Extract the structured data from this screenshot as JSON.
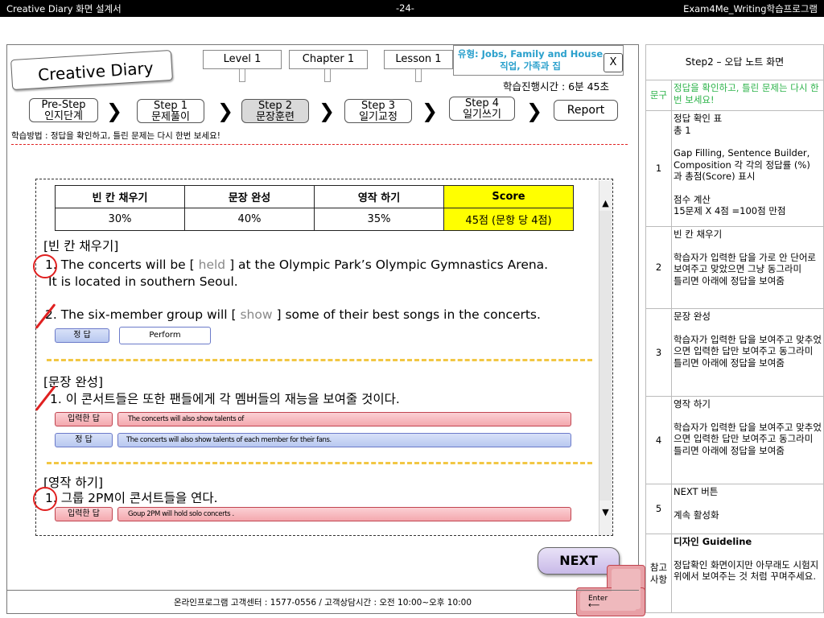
{
  "topbar": {
    "left": "Creative Diary 화면 설계서",
    "center": "-24-",
    "right": "Exam4Me_Writing학습프로그램"
  },
  "logo": "Creative Diary",
  "tabs": {
    "level": "Level 1",
    "chapter": "Chapter 1",
    "lesson": "Lesson 1"
  },
  "type_box": {
    "line1": "유형: Jobs, Family and House",
    "line2": "직업, 가족과 집"
  },
  "close": "X",
  "timer": "학습진행시간 : 6분 45초",
  "steps": [
    {
      "line1": "Pre-Step",
      "line2": "인지단계"
    },
    {
      "line1": "Step 1",
      "line2": "문제풀이"
    },
    {
      "line1": "Step 2",
      "line2": "문장훈련"
    },
    {
      "line1": "Step 3",
      "line2": "일기교정"
    },
    {
      "line1": "Step 4",
      "line2": "일기쓰기"
    }
  ],
  "report": "Report",
  "method": "학습방법 : 정답을 확인하고, 틀린 문제는 다시 한번 보세요!",
  "score_table": {
    "headers": [
      "빈 칸 채우기",
      "문장 완성",
      "영작 하기",
      "Score"
    ],
    "values": [
      "30%",
      "40%",
      "35%",
      "45점 (문항 당 4점)"
    ]
  },
  "gap": {
    "title": "[빈 칸 채우기]",
    "q1_pre": "1. The concerts will be [",
    "q1_ans": "held",
    "q1_post": "] at the Olympic Park’s Olympic Gymnastics   Arena.",
    "q1_line2": "It is located in southern Seoul.",
    "q2_pre": "2. The six-member group will [",
    "q2_ans": "show",
    "q2_post": "] some of their best songs in the concerts.",
    "answer_label": "정      답",
    "answer": "Perform"
  },
  "sentence": {
    "title": "[문장 완성]",
    "q1": "1. 이 콘서트들은 또한 팬들에게 각 멤버들의 재능을 보여줄 것이다.",
    "input_label": "입력한 답",
    "input": "The concerts will also show talents of",
    "answer_label": "정      답",
    "answer": "The concerts will also show talents of each member for their fans."
  },
  "composition": {
    "title": "[영작 하기]",
    "q1": "1. 그룹 2PM이 콘서트들을 연다.",
    "input_label": "입력한 답",
    "input": "Goup 2PM will hold solo concerts ."
  },
  "next": "NEXT",
  "enter": "Enter",
  "footer": "온라인프로그램 고객센터 : 1577-0556   / 고객상담시간 : 오전 10:00~오후 10:00",
  "panel": {
    "header": "Step2 – 오답 노트 화면",
    "intro_num": "문구",
    "intro_text": "정답을 확인하고, 틀린 문제는 다시 한번 보세요!",
    "rows": [
      {
        "num": "1",
        "lines": [
          "정답 확인 표",
          "총 1",
          "",
          "Gap Filling, Sentence Builder, Composition 각 각의 정답률 (%) 과 총점(Score) 표시",
          "",
          "점수 계산",
          "15문제 X 4점 =100점 만점"
        ]
      },
      {
        "num": "2",
        "lines": [
          "빈 칸 채우기",
          "",
          "학습자가 입력한 답을 가로 안 단어로 보여주고 맞았으면 그냥 동그라미",
          "틀리면 아래에 정답을 보여줌"
        ]
      },
      {
        "num": "3",
        "lines": [
          "문장 완성",
          "",
          "학습자가 입력한 답을 보여주고 맞추었으면 입력한 답만 보여주고 동그라미",
          "틀리면 아래에 정답을 보여줌"
        ]
      },
      {
        "num": "4",
        "lines": [
          "영작 하기",
          "",
          "학습자가 입력한 답을 보여주고 맞추었으면 입력한 답만 보여주고 동그라미",
          "틀리면 아래에 정답을 보여줌"
        ]
      },
      {
        "num": "5",
        "lines": [
          "NEXT 버튼",
          "",
          "계속 활성화"
        ]
      }
    ],
    "ref_num": "참고사항",
    "ref_title": "디자인 Guideline",
    "ref_text": "정답확인 화면이지만 아무래도 시험지위에서 보여주는 것 처럼 꾸며주세요."
  }
}
